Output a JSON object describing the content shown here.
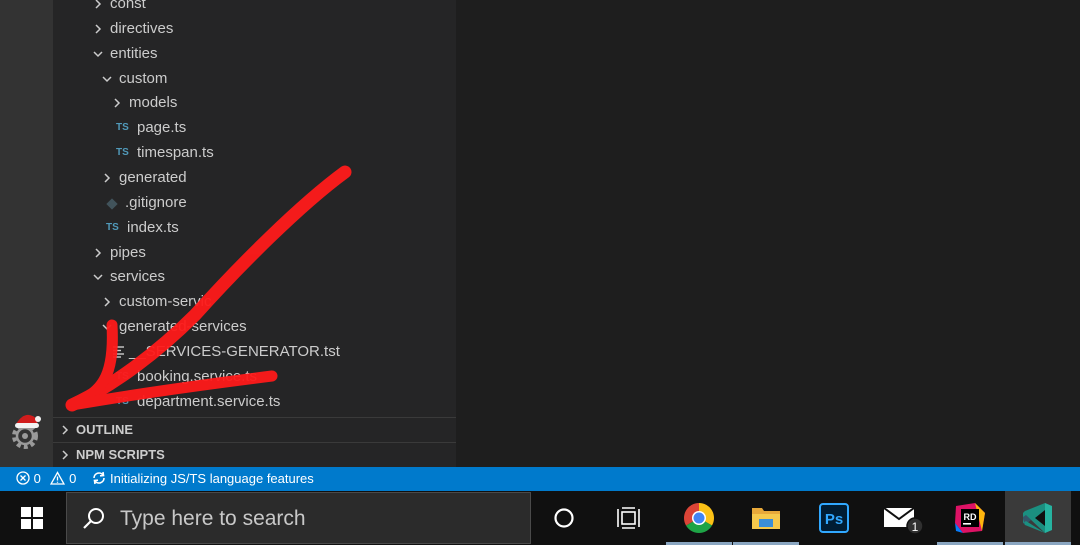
{
  "explorer": {
    "items": [
      {
        "label": "const",
        "kind": "folder-closed",
        "depth": 1
      },
      {
        "label": "directives",
        "kind": "folder-closed",
        "depth": 1
      },
      {
        "label": "entities",
        "kind": "folder-open",
        "depth": 1
      },
      {
        "label": "custom",
        "kind": "folder-open",
        "depth": 2
      },
      {
        "label": "models",
        "kind": "folder-closed",
        "depth": 3
      },
      {
        "label": "page.ts",
        "kind": "ts-file",
        "depth": 3
      },
      {
        "label": "timespan.ts",
        "kind": "ts-file",
        "depth": 3
      },
      {
        "label": "generated",
        "kind": "folder-closed",
        "depth": 2
      },
      {
        "label": ".gitignore",
        "kind": "git-file",
        "depth": 2
      },
      {
        "label": "index.ts",
        "kind": "ts-file",
        "depth": 2
      },
      {
        "label": "pipes",
        "kind": "folder-closed",
        "depth": 1
      },
      {
        "label": "services",
        "kind": "folder-open",
        "depth": 1
      },
      {
        "label": "custom-servic",
        "kind": "folder-closed",
        "depth": 2
      },
      {
        "label": "generated-services",
        "kind": "folder-open",
        "depth": 2
      },
      {
        "label": "__SERVICES-GENERATOR.tst",
        "kind": "text-file",
        "depth": 3
      },
      {
        "label": "booking.service.ts",
        "kind": "ts-file",
        "depth": 3
      },
      {
        "label": "department.service.ts",
        "kind": "ts-file",
        "depth": 3
      }
    ],
    "ts_badge": "TS",
    "outline_label": "OUTLINE",
    "npm_scripts_label": "NPM SCRIPTS"
  },
  "status_bar": {
    "errors": "0",
    "warnings": "0",
    "message": "Initializing JS/TS language features"
  },
  "taskbar": {
    "search_placeholder": "Type here to search",
    "mail_badge": "1",
    "rider_label": "RD",
    "photoshop_label": "Ps",
    "icons": [
      "windows-start-icon",
      "search-icon",
      "cortana-circle-icon",
      "task-view-icon",
      "chrome-icon",
      "file-explorer-icon",
      "photoshop-icon",
      "mail-icon",
      "rider-icon",
      "vscode-icon"
    ]
  },
  "colors": {
    "activity_bar": "#333333",
    "sidebar": "#252526",
    "editor": "#1e1e1e",
    "status_bar": "#007acc",
    "taskbar": "#101010",
    "ts_badge": "#519aba",
    "annotation_arrow": "#ff0000"
  }
}
